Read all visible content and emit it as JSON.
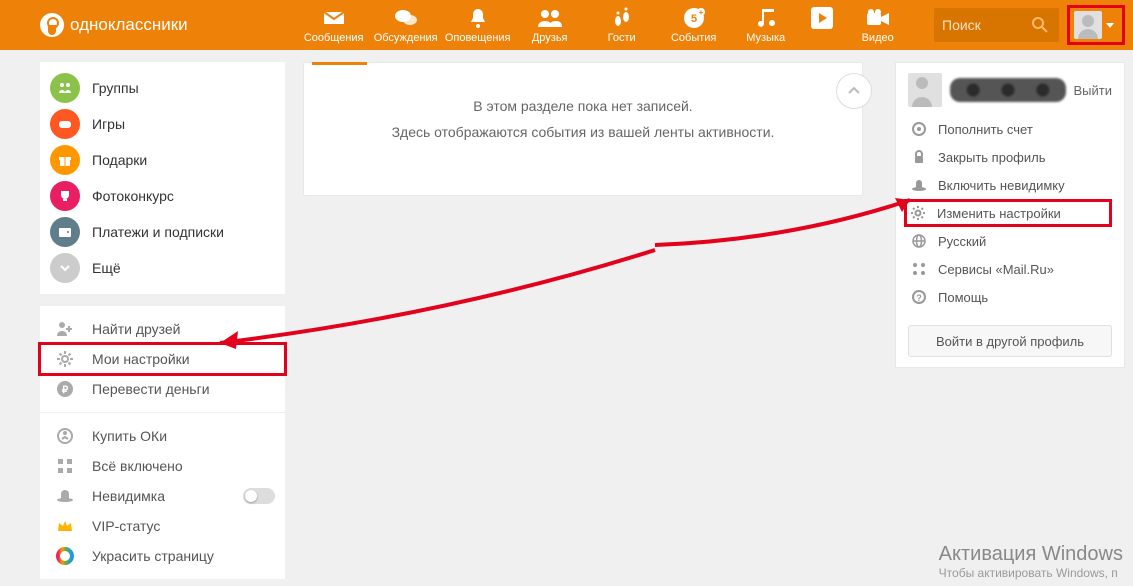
{
  "brand": "одноклассники",
  "nav": {
    "messages": "Сообщения",
    "discussions": "Обсуждения",
    "notifications": "Оповещения",
    "friends": "Друзья",
    "guests": "Гости",
    "events": "События",
    "music": "Музыка",
    "video": "Видео"
  },
  "search": {
    "placeholder": "Поиск"
  },
  "sidebar1": {
    "groups": "Группы",
    "games": "Игры",
    "gifts": "Подарки",
    "photo": "Фотоконкурс",
    "payments": "Платежи и подписки",
    "more": "Ещё"
  },
  "sidebar2": {
    "find": "Найти друзей",
    "settings": "Мои настройки",
    "transfer": "Перевести деньги",
    "buy": "Купить ОКи",
    "all": "Всё включено",
    "invis": "Невидимка",
    "vip": "VIP-статус",
    "decorate": "Украсить страницу"
  },
  "center": {
    "empty1": "В этом разделе пока нет записей.",
    "empty2": "Здесь отображаются события из вашей ленты активности."
  },
  "usermenu": {
    "logout": "Выйти",
    "topup": "Пополнить счет",
    "close": "Закрыть профиль",
    "invis": "Включить невидимку",
    "settings": "Изменить настройки",
    "lang": "Русский",
    "mailru": "Сервисы «Mail.Ru»",
    "help": "Помощь",
    "other": "Войти в другой профиль"
  },
  "watermark": {
    "title": "Активация Windows",
    "sub": "Чтобы активировать Windows, п"
  }
}
